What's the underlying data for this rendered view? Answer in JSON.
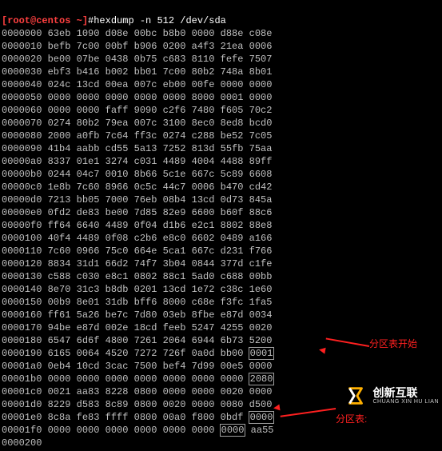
{
  "prompt": {
    "user": "[root@centos ~]",
    "hash": "#",
    "command": "hexdump -n 512 /dev/sda"
  },
  "annotations": {
    "start": "分区表开始",
    "end": "分区表:"
  },
  "watermark": {
    "cn": "创新互联",
    "en": "CHUANG XIN HU LIAN"
  },
  "hex": {
    "rows": [
      {
        "off": "0000000",
        "w": [
          "63eb",
          "1090",
          "d08e",
          "00bc",
          "b8b0",
          "0000",
          "d88e",
          "c08e"
        ]
      },
      {
        "off": "0000010",
        "w": [
          "befb",
          "7c00",
          "00bf",
          "b906",
          "0200",
          "a4f3",
          "21ea",
          "0006"
        ]
      },
      {
        "off": "0000020",
        "w": [
          "be00",
          "07be",
          "0438",
          "0b75",
          "c683",
          "8110",
          "fefe",
          "7507"
        ]
      },
      {
        "off": "0000030",
        "w": [
          "ebf3",
          "b416",
          "b002",
          "bb01",
          "7c00",
          "80b2",
          "748a",
          "8b01"
        ]
      },
      {
        "off": "0000040",
        "w": [
          "024c",
          "13cd",
          "00ea",
          "007c",
          "eb00",
          "00fe",
          "0000",
          "0000"
        ]
      },
      {
        "off": "0000050",
        "w": [
          "0000",
          "0000",
          "0000",
          "0000",
          "0000",
          "8000",
          "0001",
          "0000"
        ]
      },
      {
        "off": "0000060",
        "w": [
          "0000",
          "0000",
          "faff",
          "9090",
          "c2f6",
          "7480",
          "f605",
          "70c2"
        ]
      },
      {
        "off": "0000070",
        "w": [
          "0274",
          "80b2",
          "79ea",
          "007c",
          "3100",
          "8ec0",
          "8ed8",
          "bcd0"
        ]
      },
      {
        "off": "0000080",
        "w": [
          "2000",
          "a0fb",
          "7c64",
          "ff3c",
          "0274",
          "c288",
          "be52",
          "7c05"
        ]
      },
      {
        "off": "0000090",
        "w": [
          "41b4",
          "aabb",
          "cd55",
          "5a13",
          "7252",
          "813d",
          "55fb",
          "75aa"
        ]
      },
      {
        "off": "00000a0",
        "w": [
          "8337",
          "01e1",
          "3274",
          "c031",
          "4489",
          "4004",
          "4488",
          "89ff"
        ]
      },
      {
        "off": "00000b0",
        "w": [
          "0244",
          "04c7",
          "0010",
          "8b66",
          "5c1e",
          "667c",
          "5c89",
          "6608"
        ]
      },
      {
        "off": "00000c0",
        "w": [
          "1e8b",
          "7c60",
          "8966",
          "0c5c",
          "44c7",
          "0006",
          "b470",
          "cd42"
        ]
      },
      {
        "off": "00000d0",
        "w": [
          "7213",
          "bb05",
          "7000",
          "76eb",
          "08b4",
          "13cd",
          "0d73",
          "845a"
        ]
      },
      {
        "off": "00000e0",
        "w": [
          "0fd2",
          "de83",
          "be00",
          "7d85",
          "82e9",
          "6600",
          "b60f",
          "88c6"
        ]
      },
      {
        "off": "00000f0",
        "w": [
          "ff64",
          "6640",
          "4489",
          "0f04",
          "d1b6",
          "e2c1",
          "8802",
          "88e8"
        ]
      },
      {
        "off": "0000100",
        "w": [
          "40f4",
          "4489",
          "0f08",
          "c2b6",
          "e8c0",
          "6602",
          "0489",
          "a166"
        ]
      },
      {
        "off": "0000110",
        "w": [
          "7c60",
          "0966",
          "75c0",
          "664e",
          "5ca1",
          "667c",
          "d231",
          "f766"
        ]
      },
      {
        "off": "0000120",
        "w": [
          "8834",
          "31d1",
          "66d2",
          "74f7",
          "3b04",
          "0844",
          "377d",
          "c1fe"
        ]
      },
      {
        "off": "0000130",
        "w": [
          "c588",
          "c030",
          "e8c1",
          "0802",
          "88c1",
          "5ad0",
          "c688",
          "00bb"
        ]
      },
      {
        "off": "0000140",
        "w": [
          "8e70",
          "31c3",
          "b8db",
          "0201",
          "13cd",
          "1e72",
          "c38c",
          "1e60"
        ]
      },
      {
        "off": "0000150",
        "w": [
          "00b9",
          "8e01",
          "31db",
          "bff6",
          "8000",
          "c68e",
          "f3fc",
          "1fa5"
        ]
      },
      {
        "off": "0000160",
        "w": [
          "ff61",
          "5a26",
          "be7c",
          "7d80",
          "03eb",
          "8fbe",
          "e87d",
          "0034"
        ]
      },
      {
        "off": "0000170",
        "w": [
          "94be",
          "e87d",
          "002e",
          "18cd",
          "feeb",
          "5247",
          "4255",
          "0020"
        ]
      },
      {
        "off": "0000180",
        "w": [
          "6547",
          "6d6f",
          "4800",
          "7261",
          "2064",
          "6944",
          "6b73",
          "5200"
        ]
      },
      {
        "off": "0000190",
        "w": [
          "6165",
          "0064",
          "4520",
          "7272",
          "726f",
          "0a0d",
          "bb00",
          "0001"
        ],
        "box": 7
      },
      {
        "off": "00001a0",
        "w": [
          "0eb4",
          "10cd",
          "3cac",
          "7500",
          "bef4",
          "7d99",
          "00e5",
          "0000"
        ]
      },
      {
        "off": "00001b0",
        "w": [
          "0000",
          "0000",
          "0000",
          "0000",
          "0000",
          "0000",
          "0000",
          "2080"
        ],
        "box": 7
      },
      {
        "off": "00001c0",
        "w": [
          "0021",
          "aa83",
          "8228",
          "0800",
          "0000",
          "0000",
          "0020",
          "0000"
        ]
      },
      {
        "off": "00001d0",
        "w": [
          "8229",
          "d583",
          "8c89",
          "0800",
          "0020",
          "0000",
          "0080",
          "d500"
        ]
      },
      {
        "off": "00001e0",
        "w": [
          "8c8a",
          "fe83",
          "ffff",
          "0800",
          "00a0",
          "f800",
          "0bdf",
          "0000"
        ],
        "box": 7
      },
      {
        "off": "00001f0",
        "w": [
          "0000",
          "0000",
          "0000",
          "0000",
          "0000",
          "0000",
          "0000",
          "aa55"
        ],
        "box": 6
      },
      {
        "off": "0000200",
        "w": []
      }
    ]
  }
}
